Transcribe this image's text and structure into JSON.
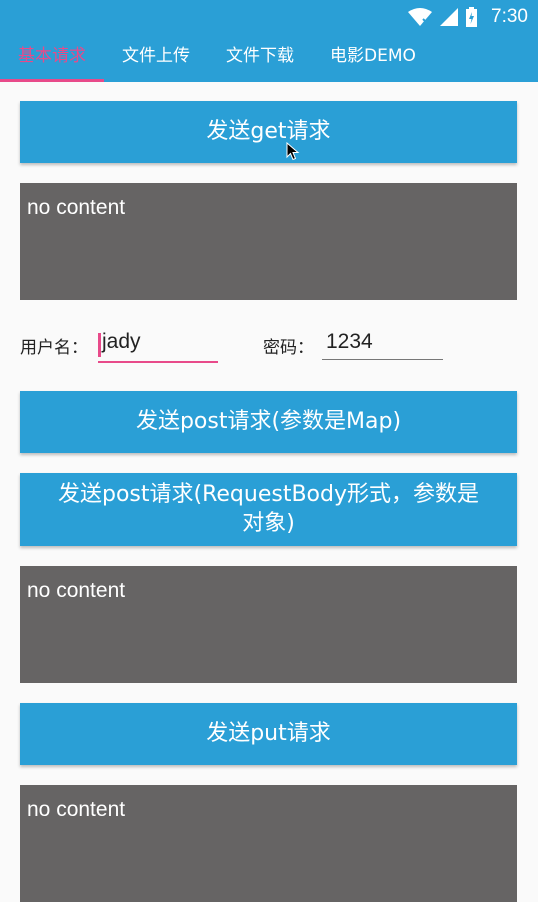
{
  "status_bar": {
    "time": "7:30",
    "icons": [
      "wifi-icon",
      "signal-icon",
      "battery-icon"
    ]
  },
  "tabs": [
    {
      "label": "基本请求",
      "active": true
    },
    {
      "label": "文件上传",
      "active": false
    },
    {
      "label": "文件下载",
      "active": false
    },
    {
      "label": "电影DEMO",
      "active": false
    }
  ],
  "get_button": {
    "label": "发送get请求"
  },
  "get_result": {
    "text": "no content"
  },
  "form": {
    "username_label": "用户名：",
    "username_value": "jady",
    "password_label": "密码：",
    "password_value": "1234"
  },
  "post_map_button": {
    "label": "发送post请求(参数是Map)"
  },
  "post_body_button": {
    "label": "发送post请求(RequestBody形式，参数是对象)"
  },
  "post_result": {
    "text": "no content"
  },
  "put_button": {
    "label": "发送put请求"
  },
  "put_result": {
    "text": "no content"
  },
  "colors": {
    "primary": "#2a9fd6",
    "accent": "#e84a8a",
    "content_bg": "#666464",
    "page_bg": "#fafafa"
  }
}
